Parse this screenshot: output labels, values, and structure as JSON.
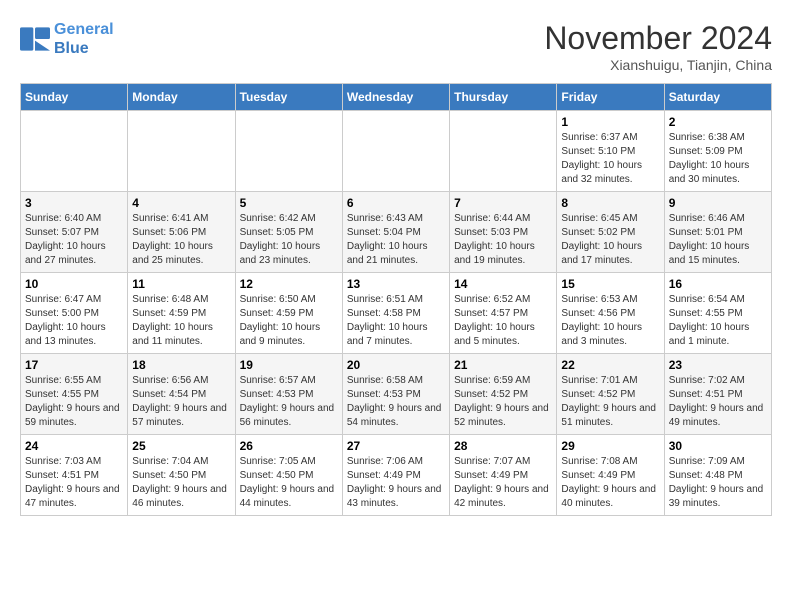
{
  "logo": {
    "line1": "General",
    "line2": "Blue"
  },
  "title": "November 2024",
  "location": "Xianshuigu, Tianjin, China",
  "weekdays": [
    "Sunday",
    "Monday",
    "Tuesday",
    "Wednesday",
    "Thursday",
    "Friday",
    "Saturday"
  ],
  "weeks": [
    [
      {
        "day": "",
        "info": ""
      },
      {
        "day": "",
        "info": ""
      },
      {
        "day": "",
        "info": ""
      },
      {
        "day": "",
        "info": ""
      },
      {
        "day": "",
        "info": ""
      },
      {
        "day": "1",
        "info": "Sunrise: 6:37 AM\nSunset: 5:10 PM\nDaylight: 10 hours and 32 minutes."
      },
      {
        "day": "2",
        "info": "Sunrise: 6:38 AM\nSunset: 5:09 PM\nDaylight: 10 hours and 30 minutes."
      }
    ],
    [
      {
        "day": "3",
        "info": "Sunrise: 6:40 AM\nSunset: 5:07 PM\nDaylight: 10 hours and 27 minutes."
      },
      {
        "day": "4",
        "info": "Sunrise: 6:41 AM\nSunset: 5:06 PM\nDaylight: 10 hours and 25 minutes."
      },
      {
        "day": "5",
        "info": "Sunrise: 6:42 AM\nSunset: 5:05 PM\nDaylight: 10 hours and 23 minutes."
      },
      {
        "day": "6",
        "info": "Sunrise: 6:43 AM\nSunset: 5:04 PM\nDaylight: 10 hours and 21 minutes."
      },
      {
        "day": "7",
        "info": "Sunrise: 6:44 AM\nSunset: 5:03 PM\nDaylight: 10 hours and 19 minutes."
      },
      {
        "day": "8",
        "info": "Sunrise: 6:45 AM\nSunset: 5:02 PM\nDaylight: 10 hours and 17 minutes."
      },
      {
        "day": "9",
        "info": "Sunrise: 6:46 AM\nSunset: 5:01 PM\nDaylight: 10 hours and 15 minutes."
      }
    ],
    [
      {
        "day": "10",
        "info": "Sunrise: 6:47 AM\nSunset: 5:00 PM\nDaylight: 10 hours and 13 minutes."
      },
      {
        "day": "11",
        "info": "Sunrise: 6:48 AM\nSunset: 4:59 PM\nDaylight: 10 hours and 11 minutes."
      },
      {
        "day": "12",
        "info": "Sunrise: 6:50 AM\nSunset: 4:59 PM\nDaylight: 10 hours and 9 minutes."
      },
      {
        "day": "13",
        "info": "Sunrise: 6:51 AM\nSunset: 4:58 PM\nDaylight: 10 hours and 7 minutes."
      },
      {
        "day": "14",
        "info": "Sunrise: 6:52 AM\nSunset: 4:57 PM\nDaylight: 10 hours and 5 minutes."
      },
      {
        "day": "15",
        "info": "Sunrise: 6:53 AM\nSunset: 4:56 PM\nDaylight: 10 hours and 3 minutes."
      },
      {
        "day": "16",
        "info": "Sunrise: 6:54 AM\nSunset: 4:55 PM\nDaylight: 10 hours and 1 minute."
      }
    ],
    [
      {
        "day": "17",
        "info": "Sunrise: 6:55 AM\nSunset: 4:55 PM\nDaylight: 9 hours and 59 minutes."
      },
      {
        "day": "18",
        "info": "Sunrise: 6:56 AM\nSunset: 4:54 PM\nDaylight: 9 hours and 57 minutes."
      },
      {
        "day": "19",
        "info": "Sunrise: 6:57 AM\nSunset: 4:53 PM\nDaylight: 9 hours and 56 minutes."
      },
      {
        "day": "20",
        "info": "Sunrise: 6:58 AM\nSunset: 4:53 PM\nDaylight: 9 hours and 54 minutes."
      },
      {
        "day": "21",
        "info": "Sunrise: 6:59 AM\nSunset: 4:52 PM\nDaylight: 9 hours and 52 minutes."
      },
      {
        "day": "22",
        "info": "Sunrise: 7:01 AM\nSunset: 4:52 PM\nDaylight: 9 hours and 51 minutes."
      },
      {
        "day": "23",
        "info": "Sunrise: 7:02 AM\nSunset: 4:51 PM\nDaylight: 9 hours and 49 minutes."
      }
    ],
    [
      {
        "day": "24",
        "info": "Sunrise: 7:03 AM\nSunset: 4:51 PM\nDaylight: 9 hours and 47 minutes."
      },
      {
        "day": "25",
        "info": "Sunrise: 7:04 AM\nSunset: 4:50 PM\nDaylight: 9 hours and 46 minutes."
      },
      {
        "day": "26",
        "info": "Sunrise: 7:05 AM\nSunset: 4:50 PM\nDaylight: 9 hours and 44 minutes."
      },
      {
        "day": "27",
        "info": "Sunrise: 7:06 AM\nSunset: 4:49 PM\nDaylight: 9 hours and 43 minutes."
      },
      {
        "day": "28",
        "info": "Sunrise: 7:07 AM\nSunset: 4:49 PM\nDaylight: 9 hours and 42 minutes."
      },
      {
        "day": "29",
        "info": "Sunrise: 7:08 AM\nSunset: 4:49 PM\nDaylight: 9 hours and 40 minutes."
      },
      {
        "day": "30",
        "info": "Sunrise: 7:09 AM\nSunset: 4:48 PM\nDaylight: 9 hours and 39 minutes."
      }
    ]
  ]
}
